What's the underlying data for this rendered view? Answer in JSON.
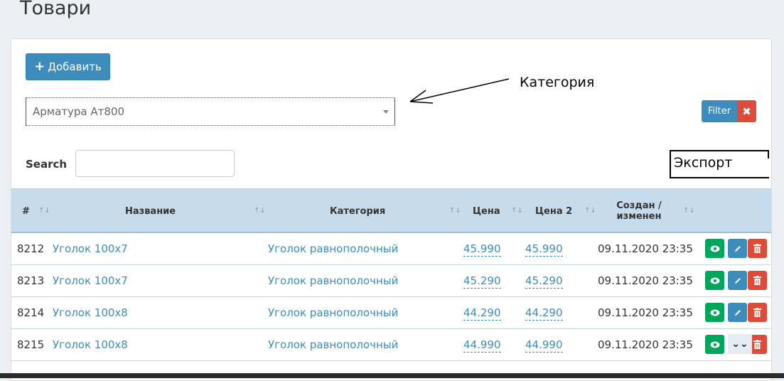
{
  "page": {
    "title": "Товари"
  },
  "toolbar": {
    "add_label": "Добавить"
  },
  "filter": {
    "category_selected": "Арматура Ат800",
    "filter_label": "Filter",
    "clear_label": "✖"
  },
  "annotation": {
    "category_label": "Категория",
    "export_label": "Экспорт"
  },
  "search": {
    "label": "Search",
    "value": ""
  },
  "table": {
    "headers": {
      "id": "#",
      "name": "Название",
      "category": "Категория",
      "price": "Цена",
      "price2": "Цена 2",
      "created": "Создан / изменен"
    },
    "rows": [
      {
        "id": "8212",
        "name": "Уголок 100x7",
        "category": "Уголок равнополочный",
        "price": "45.990",
        "price2": "45.990",
        "date": "09.11.2020 23:35"
      },
      {
        "id": "8213",
        "name": "Уголок 100x7",
        "category": "Уголок равнополочный",
        "price": "45.290",
        "price2": "45.290",
        "date": "09.11.2020 23:35"
      },
      {
        "id": "8214",
        "name": "Уголок 100x8",
        "category": "Уголок равнополочный",
        "price": "44.290",
        "price2": "44.290",
        "date": "09.11.2020 23:35"
      },
      {
        "id": "8215",
        "name": "Уголок 100x8",
        "category": "Уголок равнополочный",
        "price": "44.990",
        "price2": "44.990",
        "date": "09.11.2020 23:35"
      }
    ]
  },
  "colors": {
    "primary": "#3c8dbc",
    "success": "#00a65a",
    "danger": "#dd4b39",
    "header_bg": "#c6dced"
  }
}
